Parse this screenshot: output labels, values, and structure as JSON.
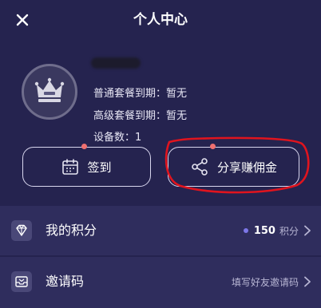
{
  "header": {
    "title": "个人中心",
    "close_icon": "close-icon"
  },
  "profile": {
    "avatar_icon": "crown-icon",
    "regular_plan_expiry": "普通套餐到期：暂无",
    "premium_plan_expiry": "高级套餐到期：暂无",
    "device_count": "设备数：1"
  },
  "actions": {
    "checkin_label": "签到",
    "checkin_icon": "calendar-icon",
    "share_label": "分享赚佣金",
    "share_icon": "share-icon"
  },
  "menu": {
    "points": {
      "label": "我的积分",
      "icon": "diamond-icon",
      "value": "150",
      "unit": "积分"
    },
    "invite": {
      "label": "邀请码",
      "icon": "inbox-icon",
      "hint": "填写好友邀请码"
    }
  },
  "colors": {
    "background": "#25234f",
    "list_background": "#2f2d5d",
    "notification_dot": "#f07070",
    "points_dot": "#7d77e8",
    "annotation": "#e0141e"
  }
}
